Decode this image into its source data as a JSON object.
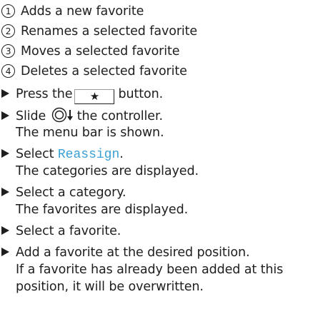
{
  "legend": [
    {
      "number": "1",
      "text": "Adds a new favorite"
    },
    {
      "number": "2",
      "text": "Renames a selected favorite"
    },
    {
      "number": "3",
      "text": "Moves a selected favorite"
    },
    {
      "number": "4",
      "text": "Deletes a selected favorite"
    }
  ],
  "steps": {
    "s1": {
      "pre": "Press the",
      "key": "★",
      "post": "button."
    },
    "s2": {
      "pre": "Slide",
      "post": "the controller.",
      "result": "The menu bar is shown."
    },
    "s3": {
      "pre": "Select",
      "softkey": "Reassign",
      "post": ".",
      "result": "The categories are displayed."
    },
    "s4": {
      "text": "Select a category.",
      "result": "The favorites are displayed."
    },
    "s5": {
      "text": "Select a favorite."
    },
    "s6": {
      "text": "Add a favorite at the desired position.",
      "result_line1": "If a favorite has already been added at this",
      "result_line2": "position, it will be overwritten."
    }
  },
  "icons": {
    "number_marker": "circled-number-icon",
    "step_marker": "arrow-right-icon",
    "controller": "controller-slide-down-icon"
  }
}
